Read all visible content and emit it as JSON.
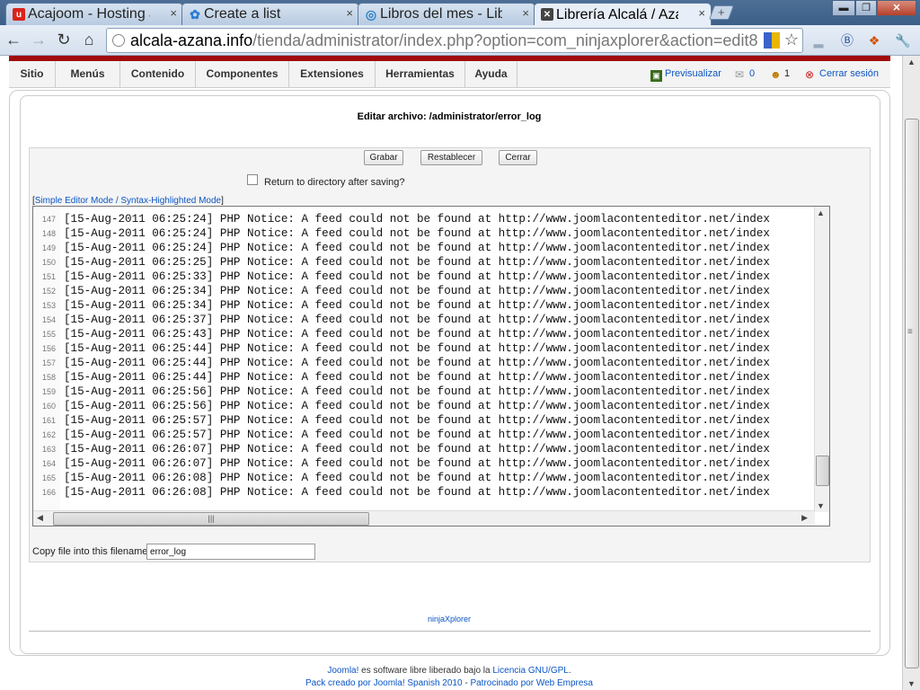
{
  "browser": {
    "tabs": [
      {
        "title": "Acajoom - Hosting Jo",
        "close": "×",
        "fav": "u",
        "color": "#d9241c"
      },
      {
        "title": "Create a list",
        "close": "×",
        "fav": "✿",
        "color": "#2a7bd4"
      },
      {
        "title": "Libros del mes - Libre",
        "close": "×",
        "fav": "◎",
        "color": "#2f82c8"
      },
      {
        "title": "Librería Alcalá / Azaña",
        "close": "×",
        "fav": "✕",
        "color": "#444"
      }
    ],
    "new_tab": "+",
    "window_controls": {
      "minimize": "▬",
      "maximize": "❐",
      "close": "✕"
    },
    "url_host": "alcala-azana.info",
    "url_path": "/tienda/administrator/index.php?option=com_ninjaxplorer&action=edit8",
    "icons": [
      "back-icon",
      "forward-icon",
      "reload-icon",
      "home-icon",
      "star-icon",
      "wrench-icon"
    ]
  },
  "menu": {
    "items": [
      "Sitio",
      "Menús",
      "Contenido",
      "Componentes",
      "Extensiones",
      "Herramientas",
      "Ayuda"
    ],
    "preview": "Previsualizar",
    "messages_count": "0",
    "users_count": "1",
    "logout": "Cerrar sesión"
  },
  "editor_page": {
    "title": "Editar archivo: /administrator/error_log",
    "buttons": {
      "save": "Grabar",
      "reset": "Restablecer",
      "close": "Cerrar"
    },
    "return_label": "Return to directory after saving?",
    "mode_open": "[",
    "mode_link": "Simple Editor Mode / Syntax-Highlighted Mode",
    "mode_close": "]",
    "copy_label": "Copy file into this filename",
    "copy_value": "error_log",
    "footer_link": "ninjaXplorer"
  },
  "log_lines": [
    {
      "n": "147",
      "text": "[15-Aug-2011 06:25:24] PHP Notice: A feed could not be found at http://www.joomlacontenteditor.net/index"
    },
    {
      "n": "148",
      "text": "[15-Aug-2011 06:25:24] PHP Notice: A feed could not be found at http://www.joomlacontenteditor.net/index"
    },
    {
      "n": "149",
      "text": "[15-Aug-2011 06:25:24] PHP Notice: A feed could not be found at http://www.joomlacontenteditor.net/index"
    },
    {
      "n": "150",
      "text": "[15-Aug-2011 06:25:25] PHP Notice: A feed could not be found at http://www.joomlacontenteditor.net/index"
    },
    {
      "n": "151",
      "text": "[15-Aug-2011 06:25:33] PHP Notice: A feed could not be found at http://www.joomlacontenteditor.net/index"
    },
    {
      "n": "152",
      "text": "[15-Aug-2011 06:25:34] PHP Notice: A feed could not be found at http://www.joomlacontenteditor.net/index"
    },
    {
      "n": "153",
      "text": "[15-Aug-2011 06:25:34] PHP Notice: A feed could not be found at http://www.joomlacontenteditor.net/index"
    },
    {
      "n": "154",
      "text": "[15-Aug-2011 06:25:37] PHP Notice: A feed could not be found at http://www.joomlacontenteditor.net/index"
    },
    {
      "n": "155",
      "text": "[15-Aug-2011 06:25:43] PHP Notice: A feed could not be found at http://www.joomlacontenteditor.net/index"
    },
    {
      "n": "156",
      "text": "[15-Aug-2011 06:25:44] PHP Notice: A feed could not be found at http://www.joomlacontenteditor.net/index"
    },
    {
      "n": "157",
      "text": "[15-Aug-2011 06:25:44] PHP Notice: A feed could not be found at http://www.joomlacontenteditor.net/index"
    },
    {
      "n": "158",
      "text": "[15-Aug-2011 06:25:44] PHP Notice: A feed could not be found at http://www.joomlacontenteditor.net/index"
    },
    {
      "n": "159",
      "text": "[15-Aug-2011 06:25:56] PHP Notice: A feed could not be found at http://www.joomlacontenteditor.net/index"
    },
    {
      "n": "160",
      "text": "[15-Aug-2011 06:25:56] PHP Notice: A feed could not be found at http://www.joomlacontenteditor.net/index"
    },
    {
      "n": "161",
      "text": "[15-Aug-2011 06:25:57] PHP Notice: A feed could not be found at http://www.joomlacontenteditor.net/index"
    },
    {
      "n": "162",
      "text": "[15-Aug-2011 06:25:57] PHP Notice: A feed could not be found at http://www.joomlacontenteditor.net/index"
    },
    {
      "n": "163",
      "text": "[15-Aug-2011 06:26:07] PHP Notice: A feed could not be found at http://www.joomlacontenteditor.net/index"
    },
    {
      "n": "164",
      "text": "[15-Aug-2011 06:26:07] PHP Notice: A feed could not be found at http://www.joomlacontenteditor.net/index"
    },
    {
      "n": "165",
      "text": "[15-Aug-2011 06:26:08] PHP Notice: A feed could not be found at http://www.joomlacontenteditor.net/index"
    },
    {
      "n": "166",
      "text": "[15-Aug-2011 06:26:08] PHP Notice: A feed could not be found at http://www.joomlacontenteditor.net/index"
    }
  ],
  "credits": {
    "joomla": "Joomla!",
    "line1_mid": " es software libre liberado bajo la ",
    "license": "Licencia GNU/GPL",
    "line1_end": ".",
    "line2_a": "Pack creado por Joomla! Spanish 2010",
    "line2_sep": " - ",
    "line2_b": "Patrocinado por Web Empresa"
  },
  "colors": {
    "accent_red": "#a10c0c",
    "link_blue": "#0b55c4"
  }
}
